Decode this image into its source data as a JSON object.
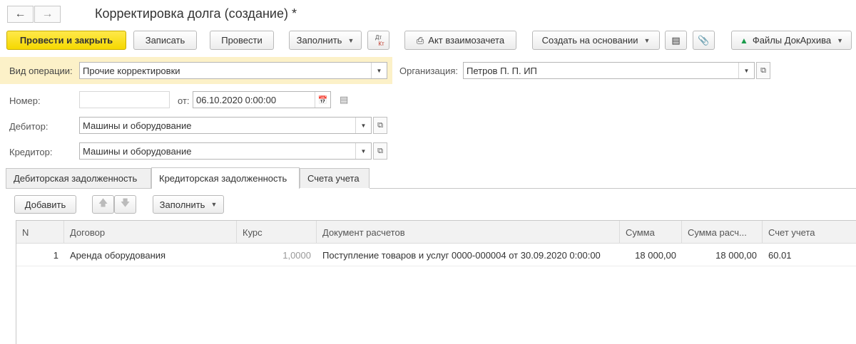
{
  "window": {
    "title": "Корректировка долга (создание) *"
  },
  "toolbar": {
    "post_close": "Провести и закрыть",
    "save": "Записать",
    "post": "Провести",
    "fill": "Заполнить",
    "dt_kt_top": "Дт",
    "dt_kt_bottom": "Кт",
    "act": "Акт взаимозачета",
    "create_based": "Создать на основании",
    "files": "Файлы ДокАрхива"
  },
  "form": {
    "operation_label": "Вид операции:",
    "operation_value": "Прочие корректировки",
    "org_label": "Организация:",
    "org_value": "Петров П. П. ИП",
    "number_label": "Номер:",
    "number_value": "",
    "date_label": "от:",
    "date_value": "06.10.2020  0:00:00",
    "debtor_label": "Дебитор:",
    "debtor_value": "Машины и оборудование",
    "creditor_label": "Кредитор:",
    "creditor_value": "Машины и оборудование"
  },
  "tabs": [
    {
      "label": "Дебиторская задолженность"
    },
    {
      "label": "Кредиторская задолженность"
    },
    {
      "label": "Счета учета"
    }
  ],
  "table_toolbar": {
    "add": "Добавить",
    "fill": "Заполнить"
  },
  "table": {
    "columns": [
      "N",
      "Договор",
      "Курс",
      "Документ расчетов",
      "Сумма",
      "Сумма расч...",
      "Счет учета"
    ],
    "rows": [
      {
        "n": "1",
        "contract": "Аренда оборудования",
        "rate": "1,0000",
        "document": "Поступление товаров и услуг 0000-000004 от 30.09.2020 0:00:00",
        "amount": "18 000,00",
        "settlement_amount": "18 000,00",
        "account": "60.01"
      }
    ]
  },
  "colors": {
    "primary_button": "#f5d800",
    "highlight": "#fcf1c8"
  }
}
